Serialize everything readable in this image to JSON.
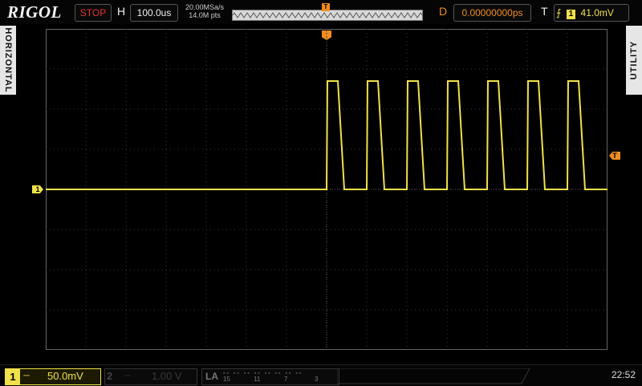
{
  "brand": "RIGOL",
  "run_state": "STOP",
  "timebase": {
    "label": "H",
    "value": "100.0us"
  },
  "acquisition": {
    "sample_rate": "20.00MSa/s",
    "memory_depth": "14.0M pts"
  },
  "delay": {
    "label": "D",
    "value": "0.00000000ps"
  },
  "trigger": {
    "label": "T",
    "source": "1",
    "level": "41.0mV",
    "marker": "T"
  },
  "side_tabs": {
    "left": "HORIZONTAL",
    "right": "UTILITY"
  },
  "channels": {
    "ch1": {
      "number": "1",
      "coupling_symbol": "⎓",
      "scale": "50.0mV",
      "color": "#f0e04a",
      "marker": "1"
    },
    "ch2": {
      "number": "2",
      "coupling_symbol": "⎓",
      "scale": "1.00 V",
      "color": "#444444"
    }
  },
  "logic_analyzer": {
    "label": "LA",
    "channel_groups": [
      "15",
      "11",
      "7",
      "3"
    ]
  },
  "clock": "22:52",
  "colors": {
    "trigger": "#f08c1e",
    "ch1": "#f0e04a",
    "stop": "#e83232",
    "grid": "#3a3a3a"
  },
  "waveform": {
    "pulse_count": 7,
    "baseline_div": 4.0,
    "high_div": 6.7,
    "pulse_start_div": 7.0,
    "pulse_period_div": 1.0,
    "duty": 0.32
  }
}
